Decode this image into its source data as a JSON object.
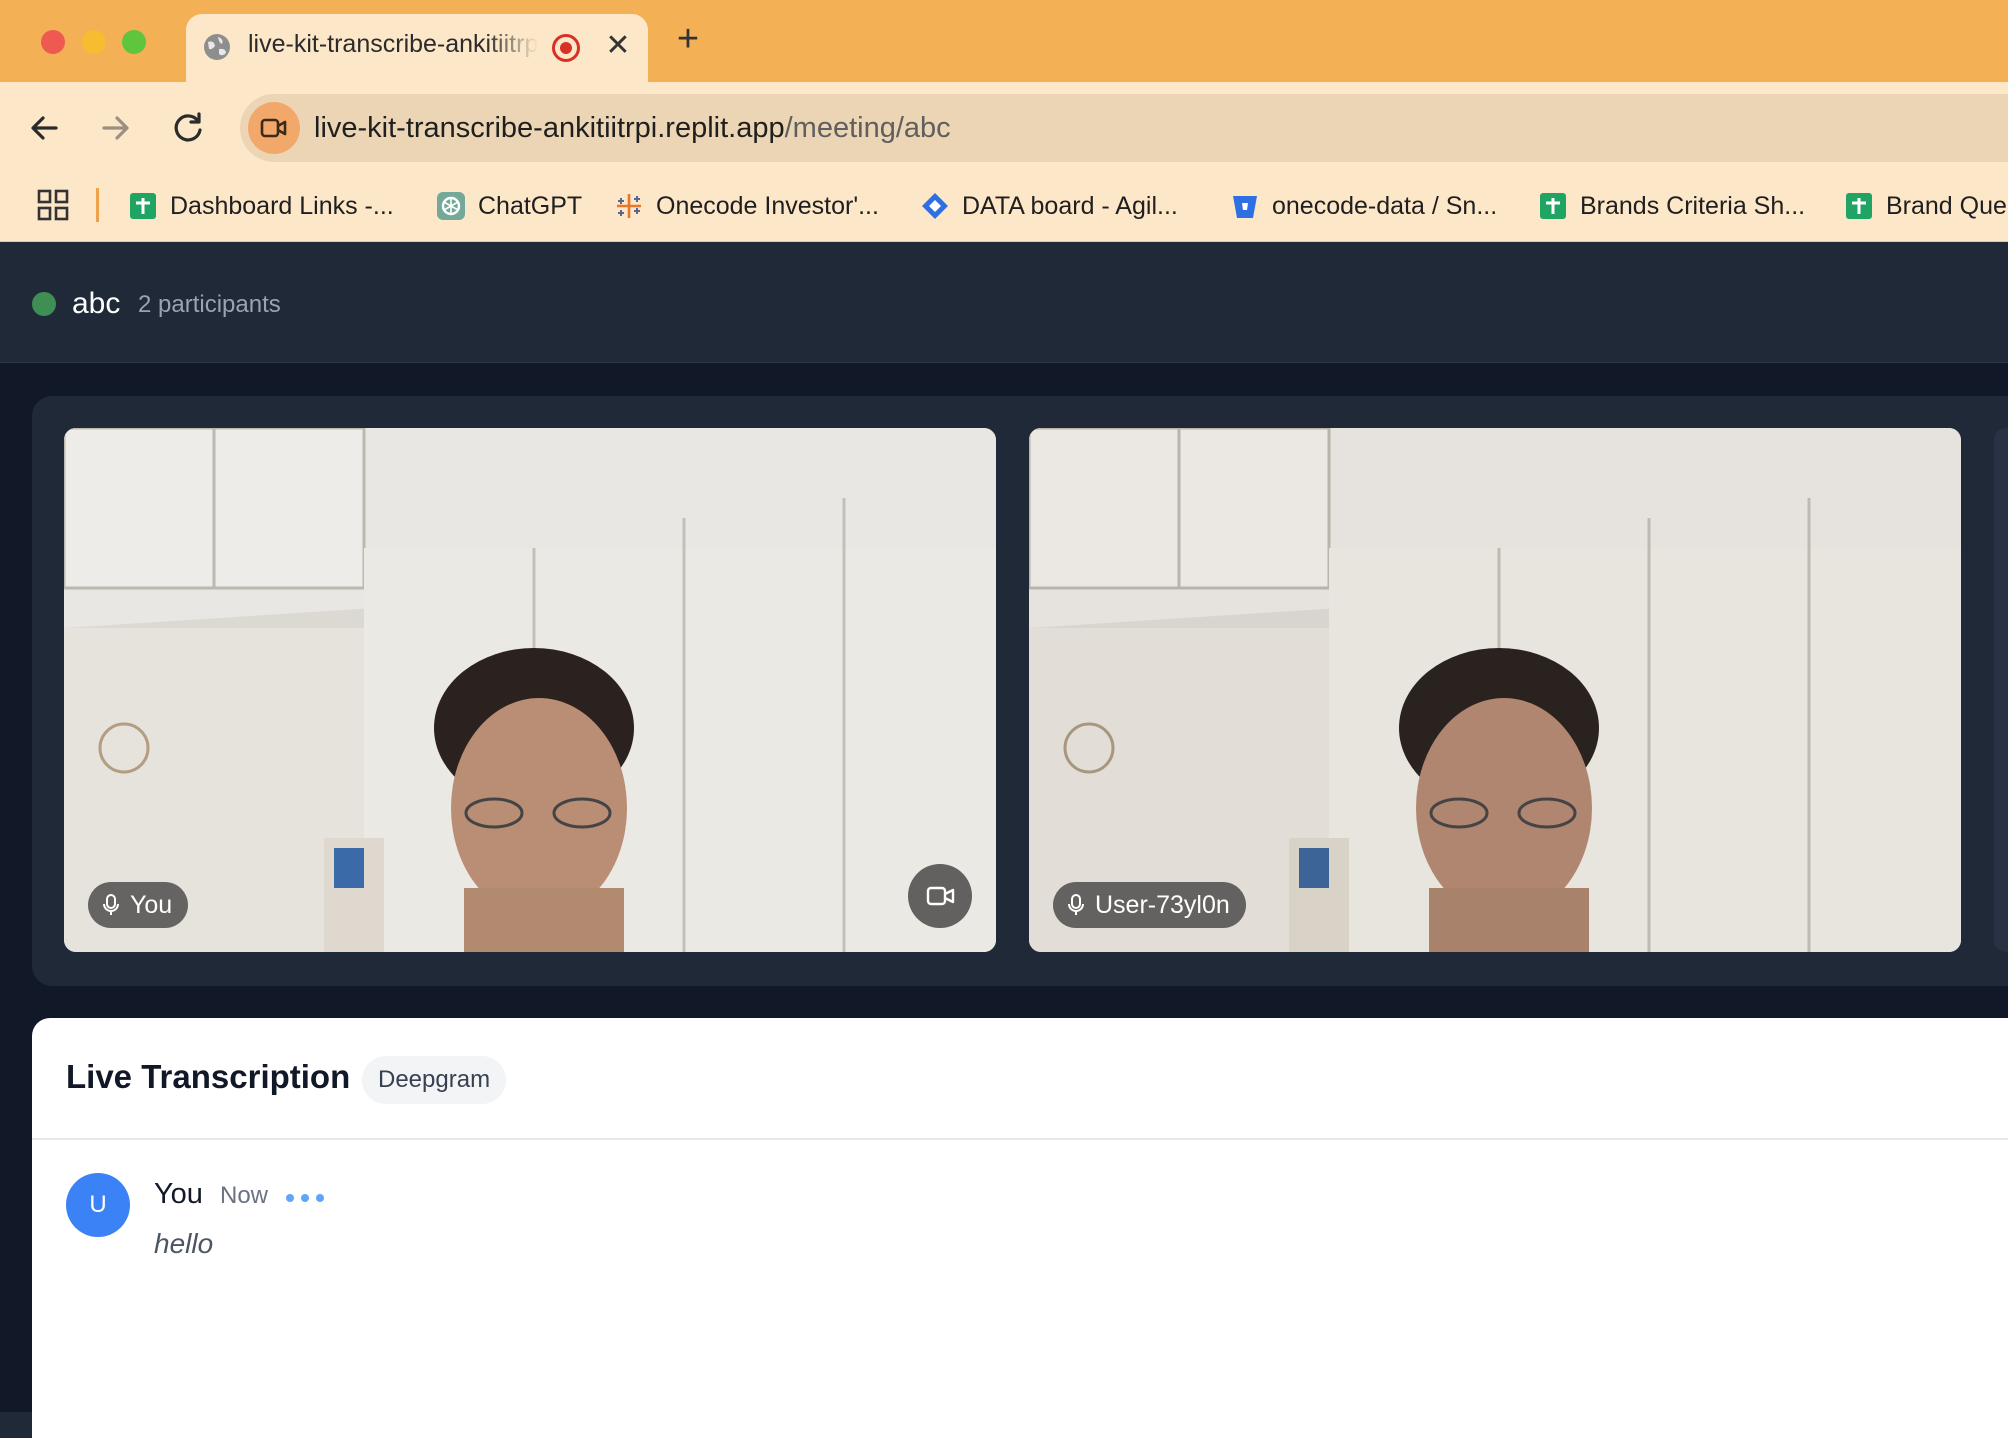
{
  "browser": {
    "tab": {
      "title": "live-kit-transcribe-ankitiitrpi.replit.app",
      "icon": "globe-icon",
      "recording_icon": "recording-icon",
      "close_glyph": "✕"
    },
    "new_tab_glyph": "+",
    "url": {
      "host": "live-kit-transcribe-ankitiitrpi.replit.app",
      "path": "/meeting/abc"
    },
    "bookmarks": [
      {
        "label": "Dashboard Links -...",
        "icon": "google-sheets-icon"
      },
      {
        "label": "ChatGPT",
        "icon": "chatgpt-icon"
      },
      {
        "label": "Onecode Investor'...",
        "icon": "tableau-icon"
      },
      {
        "label": "DATA board - Agil...",
        "icon": "jira-icon"
      },
      {
        "label": "onecode-data / Sn...",
        "icon": "bitbucket-icon"
      },
      {
        "label": "Brands Criteria Sh...",
        "icon": "google-sheets-icon"
      },
      {
        "label": "Brand Que",
        "icon": "google-sheets-icon"
      }
    ]
  },
  "room": {
    "name": "abc",
    "participants": "2 participants",
    "status_color": "#3f8f55"
  },
  "video": {
    "tiles": [
      {
        "name": "You",
        "mic_icon": "mic-icon",
        "camera_icon": "camera-icon"
      },
      {
        "name": "User-73yl0n",
        "mic_icon": "mic-icon"
      }
    ]
  },
  "transcription": {
    "title": "Live Transcription",
    "provider": "Deepgram",
    "messages": [
      {
        "avatar": "U",
        "speaker": "You",
        "time": "Now",
        "text": "hello"
      }
    ]
  },
  "colors": {
    "tabstrip": "#f3b055",
    "toolbar": "#fde7c9",
    "app_background": "#111827",
    "panel": "#1f2937",
    "avatar": "#3b82f6"
  }
}
